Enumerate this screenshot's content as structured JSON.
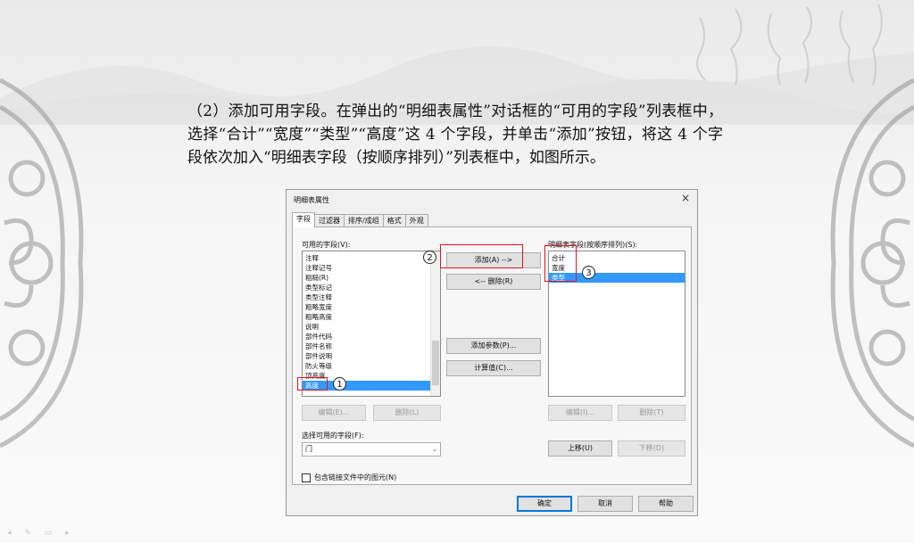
{
  "caption": {
    "text": "（2）添加可用字段。在弹出的“明细表属性”对话框的“可用的字段”列表框中，选择“合计”“宽度”“类型”“高度”这 4 个字段，并单击“添加”按钮，将这 4 个字段依次加入“明细表字段（按顺序排列）”列表框中，如图所示。"
  },
  "dialog": {
    "title": "明细表属性",
    "close": "×",
    "tabs": [
      "字段",
      "过滤器",
      "排序/成组",
      "格式",
      "外观"
    ],
    "available_label": "可用的字段(V):",
    "available_items": [
      "注释",
      "注释记号",
      "粗糙(R)",
      "类型标记",
      "类型注释",
      "粗略宽度",
      "粗略高度",
      "说明",
      "部件代码",
      "部件名称",
      "部件说明",
      "防火等级",
      "顶高度",
      "高度"
    ],
    "schedule_label": "明细表字段(按顺序排列)(S):",
    "schedule_items": [
      "合计",
      "宽度",
      "类型"
    ],
    "add_button": "添加(A) -->",
    "remove_button": "<-- 删除(R)",
    "add_param_button": "添加参数(P)...",
    "calc_value_button": "计算值(C)...",
    "edit_left": "编辑(E)...",
    "delete_left": "删除(L)",
    "edit_right": "编辑(I)...",
    "delete_right": "删除(T)",
    "select_from_label": "选择可用的字段(F):",
    "select_from_value": "门",
    "move_up": "上移(U)",
    "move_down": "下移(D)",
    "include_linked": "包含链接文件中的图元(N)",
    "ok": "确定",
    "cancel": "取消",
    "help": "帮助"
  },
  "annotations": {
    "step1": "1",
    "step2": "2",
    "step3": "3",
    "highlight_color": "#e0141d"
  }
}
